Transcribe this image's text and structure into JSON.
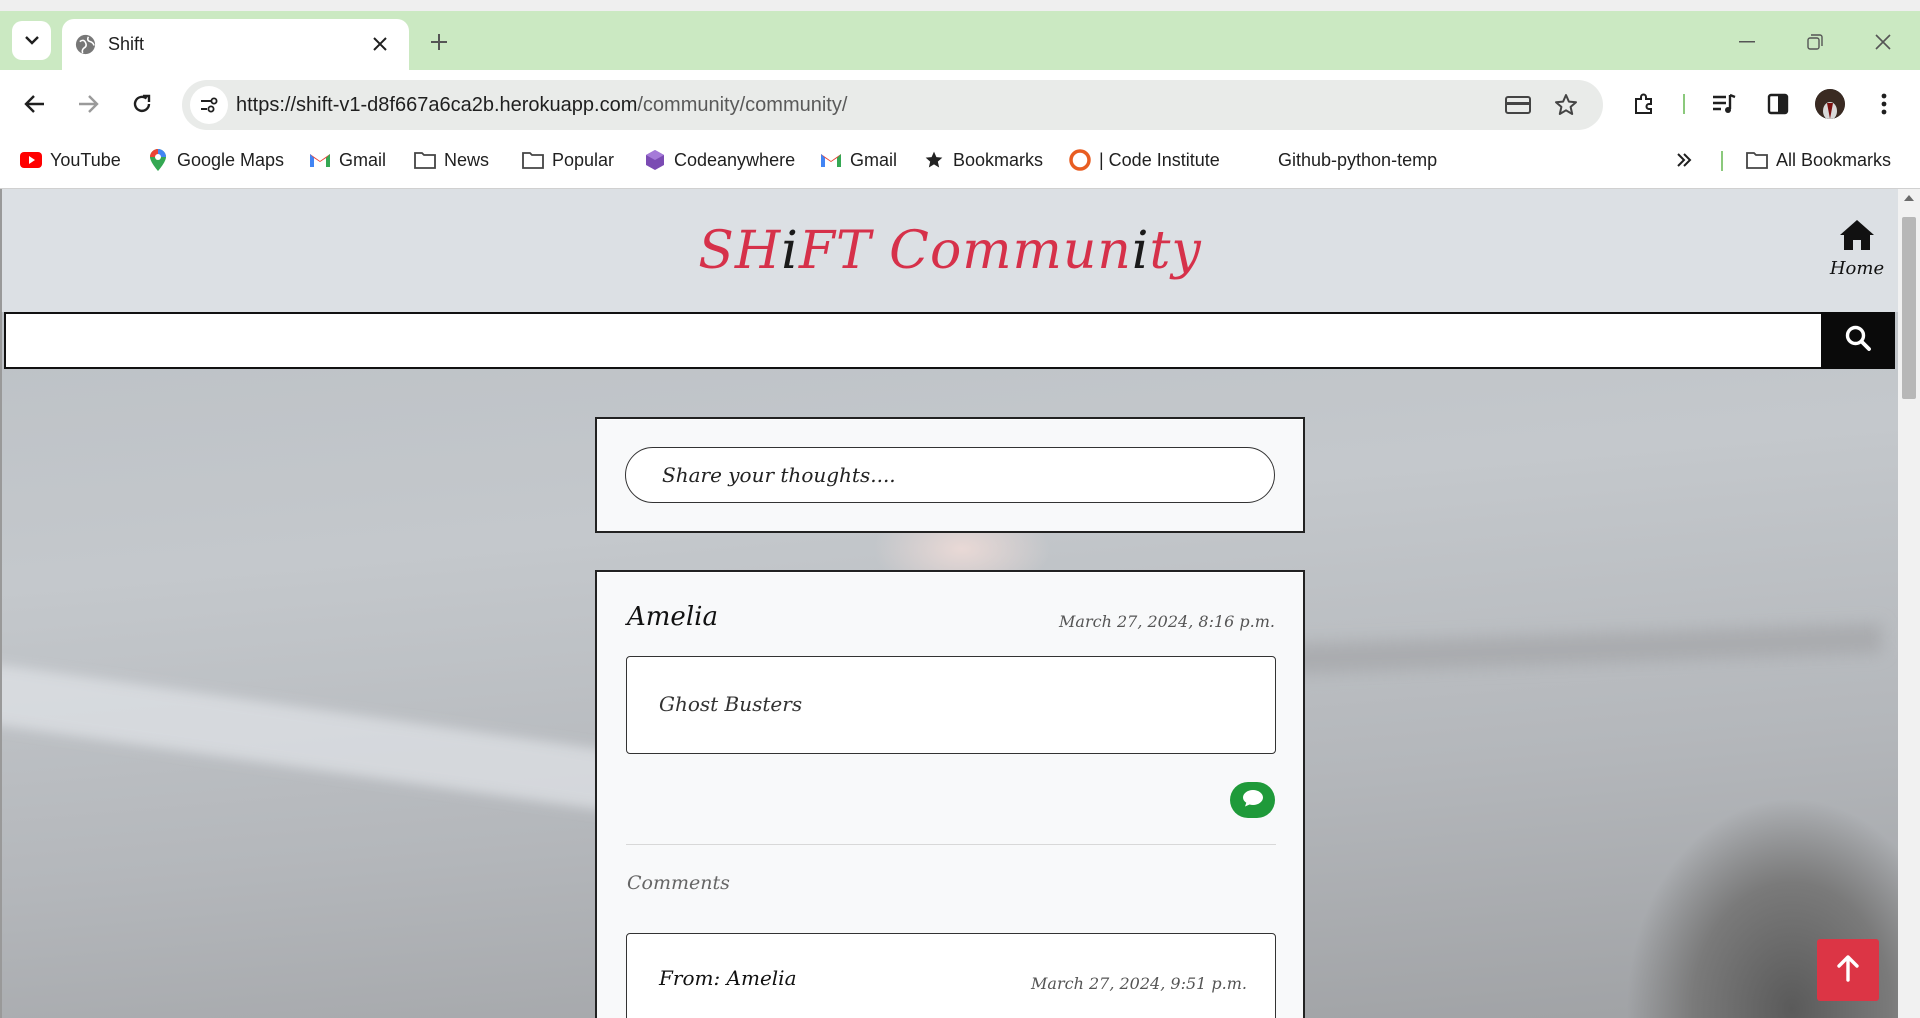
{
  "browser": {
    "tab_title": "Shift",
    "url_host": "https://shift-v1-d8f667a6ca2b.herokuapp.com",
    "url_path": "/community/community/",
    "bookmarks": [
      {
        "label": "YouTube",
        "icon": "youtube-icon"
      },
      {
        "label": "Google Maps",
        "icon": "google-maps-icon"
      },
      {
        "label": "Gmail",
        "icon": "gmail-icon"
      },
      {
        "label": "News",
        "icon": "folder-icon"
      },
      {
        "label": "Popular",
        "icon": "folder-icon"
      },
      {
        "label": "Codeanywhere",
        "icon": "codeanywhere-icon"
      },
      {
        "label": "Gmail",
        "icon": "gmail-icon"
      },
      {
        "label": "Bookmarks",
        "icon": "star-icon"
      },
      {
        "label": "| Code Institute",
        "icon": "code-institute-icon"
      },
      {
        "label": "Github-python-temp",
        "icon": ""
      }
    ],
    "all_bookmarks_label": "All Bookmarks",
    "colors": {
      "tab_strip": "#cbe9c2",
      "accent_separator": "#8bc97c"
    }
  },
  "site": {
    "brand_parts": [
      "SH",
      "i",
      "FT Commun",
      "i",
      "ty"
    ],
    "home_label": "Home",
    "search": {
      "value": "",
      "placeholder": ""
    },
    "share_placeholder": "Share your thoughts....",
    "colors": {
      "brand": "#d6314a",
      "comment_button": "#1f9a3a",
      "back_to_top": "#dc3545",
      "header_bg": "#dce0e4"
    }
  },
  "post": {
    "author": "Amelia",
    "date": "March 27, 2024, 8:16 p.m.",
    "content": "Ghost Busters",
    "comments_heading": "Comments",
    "comments": [
      {
        "from": "From: Amelia",
        "date": "March 27, 2024, 9:51 p.m."
      }
    ]
  }
}
